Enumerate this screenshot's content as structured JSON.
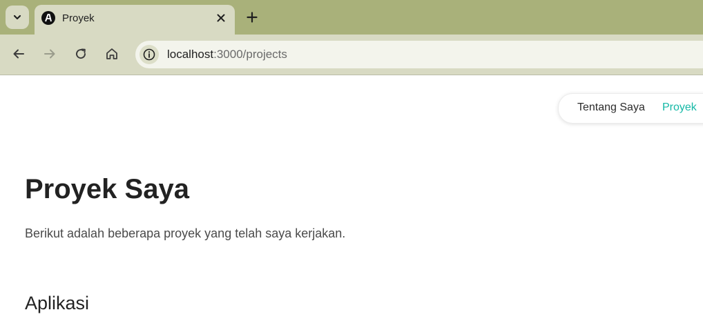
{
  "browser": {
    "tab": {
      "title": "Proyek"
    },
    "address": {
      "host": "localhost",
      "path": ":3000/projects"
    },
    "icons": {
      "tab_search": "chevron-down-icon",
      "favicon": "site-favicon",
      "close": "close-icon",
      "new_tab": "plus-icon",
      "back": "back-arrow-icon",
      "forward": "forward-arrow-icon",
      "reload": "reload-icon",
      "home": "home-icon",
      "site_info": "info-icon"
    }
  },
  "page": {
    "nav": {
      "items": [
        {
          "label": "Tentang Saya"
        },
        {
          "label": "Proyek",
          "active": true
        }
      ]
    },
    "heading": "Proyek Saya",
    "lead": "Berikut adalah beberapa proyek yang telah saya kerjakan.",
    "section_heading": "Aplikasi"
  },
  "colors": {
    "accent": "#14b8a6",
    "tabstrip": "#a9b17a",
    "toolbar": "#d8dac3"
  }
}
